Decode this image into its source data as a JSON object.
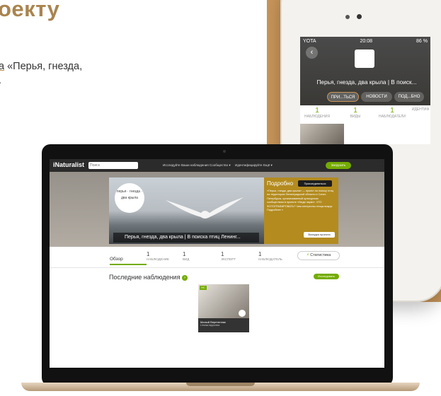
{
  "doc": {
    "heading": "оекту",
    "para_link": "а",
    "para_line1": " «Перья, гнезда,",
    "para_line2": "."
  },
  "phone": {
    "status_left": "YOTA",
    "status_time": "20:08",
    "status_right": "86 %",
    "title": "Перья, гнезда, два крыла | В поиск...",
    "buttons": [
      "ПРИ...ТЬСЯ",
      "НОВОСТИ",
      "ПОД...БНО"
    ],
    "tabs": [
      {
        "num": "1",
        "label": "НАБЛЮДЕНИЯ"
      },
      {
        "num": "1",
        "label": "ВИДЫ"
      },
      {
        "num": "1",
        "label": "НАБЛЮДАТЕЛИ"
      },
      {
        "num": "",
        "label": "ИДЕНТИФ"
      }
    ]
  },
  "laptop": {
    "brand": "iNaturalist",
    "search_placeholder": "Поиск",
    "nav": [
      "Исследуйте",
      "Ваши наблюдения",
      "Сообщество ▾",
      "Идентифицируйте",
      "Ещё ▾"
    ],
    "upload": "Загрузить",
    "circle_text": "перья · гнезда · два крыла",
    "banner_title": "Перья, гнезда, два крыла | В поиска птиц Ленинг...",
    "side_head": "Подробно",
    "side_join": "Присоединиться",
    "side_text": "«Перья, гнезда, два крыла» — проект по поиску птиц на территории Ленинградской области и Санкт-Петербурга, организованный культурным сообществом в проекте «Люди науки». ЧТО ФОТОГРАФИРОВАТЬ? Чем интересны птицы вокруг. Подробнее »",
    "side_members": "Вкладка проекта",
    "stats": [
      {
        "num": "1",
        "label": "НАБЛЮДЕНИЕ"
      },
      {
        "num": "1",
        "label": "ВИД"
      },
      {
        "num": "1",
        "label": "ЭКСПЕРТ"
      },
      {
        "num": "1",
        "label": "НАБЛЮДАТЕЛЬ"
      }
    ],
    "overview": "Обзор",
    "stat_button": "Статистика",
    "recent": "Последние наблюдения",
    "explore": "Исследовать",
    "obs_name": "Малый Веретенник",
    "obs_place": "Limosa lapponica",
    "obs_badge": "НС"
  }
}
